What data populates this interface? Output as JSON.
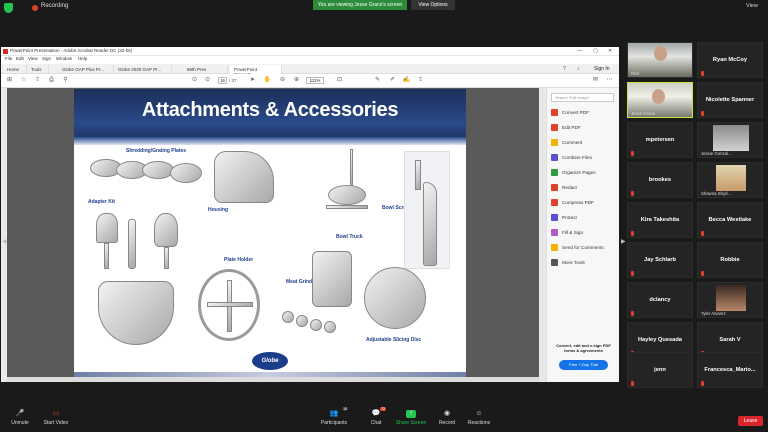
{
  "meeting": {
    "recording_label": "Recording",
    "share_banner": "You are viewing Jesse Grace's screen",
    "view_options": "View Options",
    "view_label": "View"
  },
  "window": {
    "title": "PowerPoint Presentation - Adobe Acrobat Reader DC (32-bit)",
    "menu": [
      "File",
      "Edit",
      "View",
      "Sign",
      "Window",
      "Help"
    ],
    "tabs": [
      "Home",
      "Tools",
      "Globe GAP Plus Pr...",
      "Globe 2020 GAP Pr...",
      "86th Pres",
      "PowerPoint Presentt..."
    ],
    "sign_in": "Sign In",
    "page_current": "16",
    "page_total": "/ 37",
    "zoom": "111%"
  },
  "slide": {
    "title": "Attachments & Accessories",
    "labels": {
      "shredding": "Shredding/Grating Plates",
      "adapter": "Adapter Kit",
      "housing": "Housing",
      "bowl_truck": "Bowl Truck",
      "bowl_scraper": "Bowl Scraper",
      "plate_holder": "Plate Holder",
      "meat_grinder": "Meat Grinder",
      "slicing_disc": "Adjustable Slicing Disc"
    },
    "logo": "Globe"
  },
  "tools_pane": {
    "search_placeholder": "Search 'Edit Image'",
    "items": [
      {
        "label": "Convert PDF",
        "color": "#e0412c"
      },
      {
        "label": "Edit PDF",
        "color": "#e0412c"
      },
      {
        "label": "Comment",
        "color": "#f0b400"
      },
      {
        "label": "Combine Files",
        "color": "#5a4fcf"
      },
      {
        "label": "Organize Pages",
        "color": "#2d9b40"
      },
      {
        "label": "Redact",
        "color": "#e0412c"
      },
      {
        "label": "Compress PDF",
        "color": "#e0412c"
      },
      {
        "label": "Protect",
        "color": "#5a4fcf"
      },
      {
        "label": "Fill & Sign",
        "color": "#b05cc0"
      },
      {
        "label": "Send for Comments",
        "color": "#f0b400"
      },
      {
        "label": "More Tools",
        "color": "#555555"
      }
    ],
    "promo": "Convert, edit and e-sign PDF forms & agreements",
    "trial_button": "Free 7-Day Trial"
  },
  "participants": [
    {
      "name": "Rick",
      "video": true
    },
    {
      "name": "Ryan McCoy",
      "video": false
    },
    {
      "name": "Jesse Grace",
      "video": true,
      "active": true
    },
    {
      "name": "Nicolette Spanner",
      "video": false
    },
    {
      "name": "mpetersen",
      "video": false
    },
    {
      "name": "Jessie Gonzal...",
      "video": true
    },
    {
      "name": "brookes",
      "video": false
    },
    {
      "name": "Shawna Shyd...",
      "video": true
    },
    {
      "name": "Kira Takeshita",
      "video": false
    },
    {
      "name": "Becca Westlake",
      "video": false
    },
    {
      "name": "Jay Schlarb",
      "video": false
    },
    {
      "name": "Robbie",
      "video": false
    },
    {
      "name": "dclancy",
      "video": false
    },
    {
      "name": "Tyler Alvarez",
      "video": true
    },
    {
      "name": "Hayley Quesada",
      "video": false
    },
    {
      "name": "Sarah V",
      "video": false
    },
    {
      "name": "jenn",
      "video": false
    },
    {
      "name": "Francesca_Mario...",
      "video": false
    }
  ],
  "controls": {
    "unmute": "Unmute",
    "start_video": "Start Video",
    "participants": "Participants",
    "participant_count": "18",
    "chat": "Chat",
    "chat_badge": "72",
    "share_screen": "Share Screen",
    "record": "Record",
    "reactions": "Reactions",
    "leave": "Leave"
  }
}
